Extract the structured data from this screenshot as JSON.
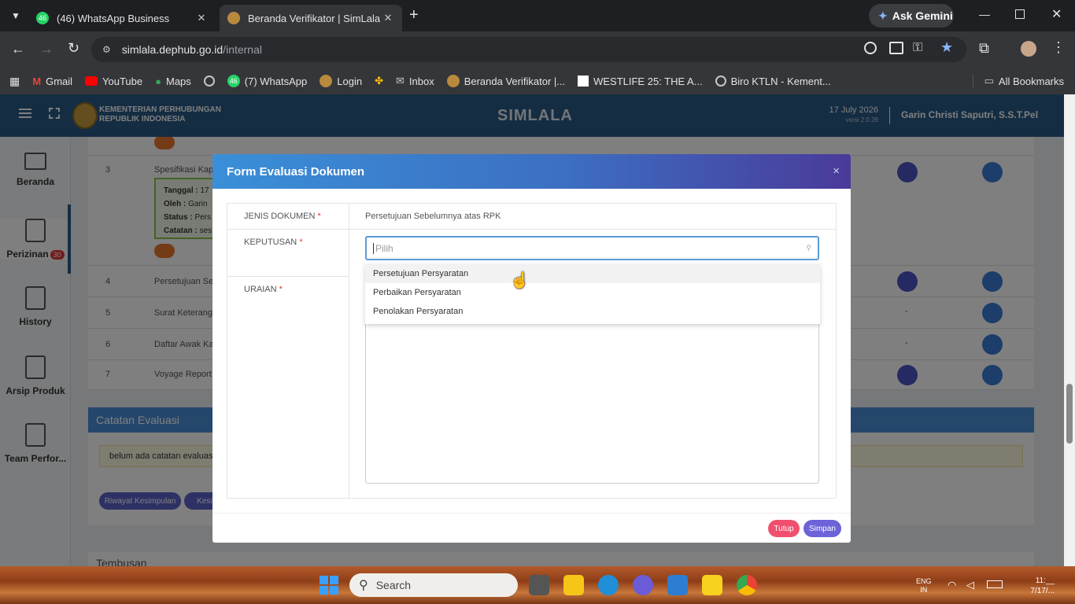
{
  "browser": {
    "tabs": [
      {
        "label": "(46) WhatsApp Business",
        "badge": "46"
      },
      {
        "label": "Beranda Verifikator | SimLala"
      }
    ],
    "new_tab": "+",
    "gemini": "Ask Gemini",
    "url_host": "simlala.dephub.go.id",
    "url_path": "/internal",
    "bookmarks": [
      "Gmail",
      "YouTube",
      "Maps",
      "(7) WhatsApp",
      "Login",
      "Inbox",
      "Beranda Verifikator |...",
      "WESTLIFE 25: THE A...",
      "Biro KTLN - Kement..."
    ],
    "bookmarks_badge": "46",
    "all_bookmarks": "All Bookmarks"
  },
  "app": {
    "org_line1": "KEMENTERIAN PERHUBUNGAN",
    "org_line2": "REPUBLIK INDONESIA",
    "title": "SIMLALA",
    "date": "17 July 2026",
    "version": "versi 2.0.28",
    "user": "Garin Christi Saputri, S.S.T.Pel"
  },
  "sidebar": {
    "items": [
      {
        "label": "Beranda"
      },
      {
        "label": "Perizinan",
        "badge": "30"
      },
      {
        "label": "History"
      },
      {
        "label": "Arsip Produk"
      },
      {
        "label": "Team Perfor..."
      }
    ]
  },
  "table": {
    "rows": [
      {
        "no": "3",
        "name": "Spesifikasi Kapa"
      },
      {
        "no": "4",
        "name": "Persetujuan Seb"
      },
      {
        "no": "5",
        "name": "Surat Keterangan",
        "dash": "-"
      },
      {
        "no": "6",
        "name": "Daftar Awak Kap",
        "dash": "-"
      },
      {
        "no": "7",
        "name": "Voyage Report ("
      }
    ],
    "detail": {
      "tanggal_label": "Tanggal :",
      "tanggal_val": "17",
      "oleh_label": "Oleh :",
      "oleh_val": "Garin",
      "status_label": "Status :",
      "status_val": "Pers",
      "catatan_label": "Catatan :",
      "catatan_val": "ses"
    }
  },
  "catatan": {
    "title": "Catatan Evaluasi",
    "empty_text": "belum ada catatan evaluasi",
    "btn_riwayat": "Riwayat Kesimpulan",
    "btn_kesim": "Kesim"
  },
  "tembusan": {
    "title": "Tembusan"
  },
  "modal": {
    "title": "Form Evaluasi Dokumen",
    "close": "×",
    "jenis_label": "JENIS DOKUMEN",
    "jenis_value": "Persetujuan Sebelumnya atas RPK",
    "keputusan_label": "KEPUTUSAN",
    "keputusan_placeholder": "Pilih",
    "uraian_label": "URAIAN",
    "required": "*",
    "options": [
      "Persetujuan Persyaratan",
      "Perbaikan Persyaratan",
      "Penolakan Persyaratan"
    ],
    "btn_tutup": "Tutup",
    "btn_simpan": "Simpan"
  },
  "taskbar": {
    "search": "Search",
    "lang": "ENG",
    "region": "IN",
    "time": "11:__",
    "date": "7/17/..."
  },
  "colors": {
    "app_header": "#2b5b87",
    "modal_gradient_start": "#3a8fd8",
    "modal_gradient_end": "#4a3a9a",
    "btn_tutup": "#f0506e",
    "btn_simpan": "#6c63d9",
    "select_border": "#5b9bd5"
  }
}
